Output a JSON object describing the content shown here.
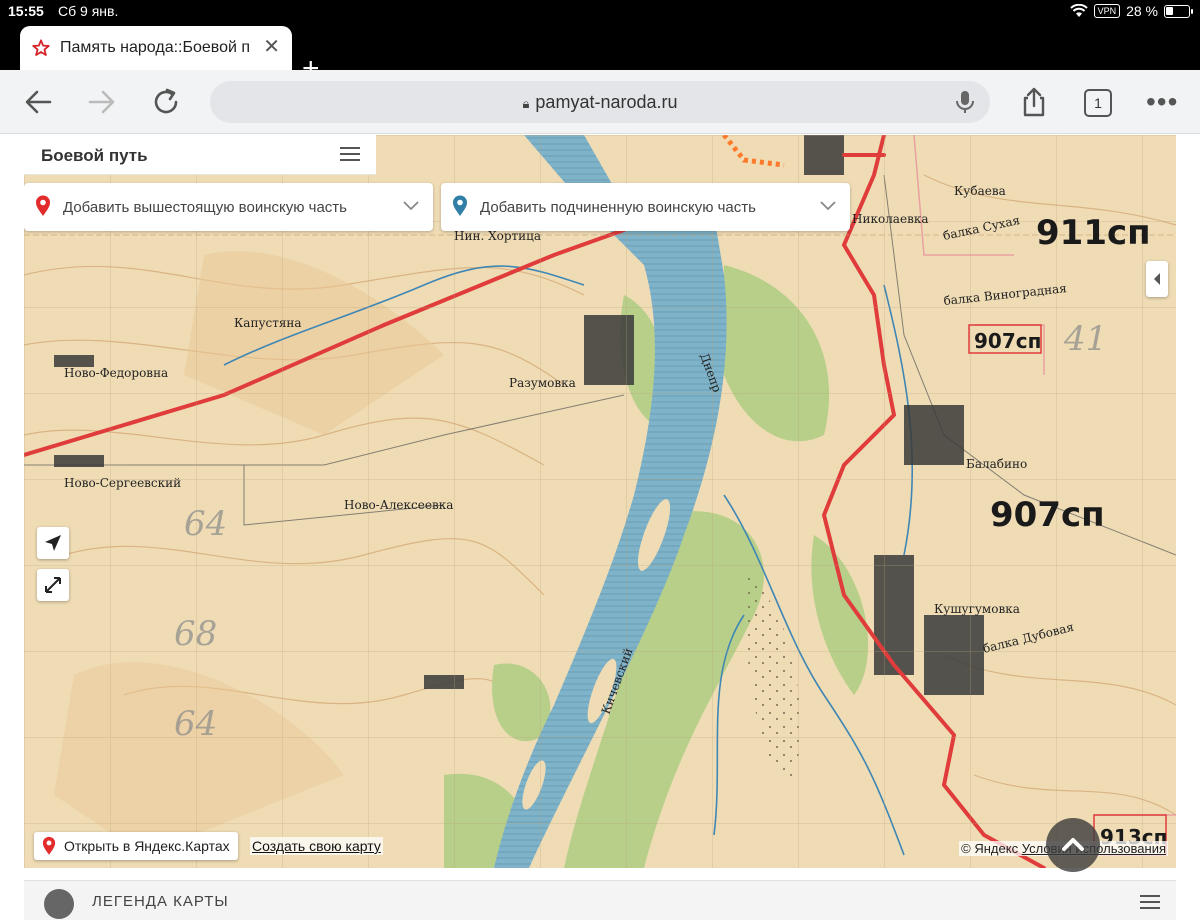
{
  "status_bar": {
    "time": "15:55",
    "date": "Сб 9 янв.",
    "vpn": "VPN",
    "battery": "28 %"
  },
  "tab": {
    "title": "Память народа::Боевой путь",
    "close": "✕"
  },
  "new_tab": "+",
  "toolbar": {
    "url": "pamyat-naroda.ru",
    "tab_count": "1",
    "more": "•••"
  },
  "panel": {
    "title": "Боевой путь"
  },
  "selectors": {
    "superior": "Добавить вышестоящую воинскую часть",
    "subordinate": "Добавить подчиненную воинскую часть"
  },
  "map_labels": {
    "units": [
      "911сп",
      "907сп",
      "907сп",
      "913сп",
      "64",
      "68"
    ],
    "places": [
      "Нин. Хортица",
      "Николаевка",
      "Кубаева",
      "Капустяна",
      "Ново-Федоровна",
      "Разумовка",
      "Балабино",
      "Ново-Сергеевский",
      "Ново-Алексеевка",
      "Кушугумовка",
      "балка Сухая",
      "балка Дубовая",
      "балка Виноградная",
      "Днепр",
      "Кичевский"
    ]
  },
  "map_footer": {
    "open_yandex": "Открыть в Яндекс.Картах",
    "create_map": "Создать свою карту",
    "copyright_prefix": "© Яндекс ",
    "copyright_link": "Условия использования"
  },
  "legend": {
    "title": "ЛЕГЕНДА КАРТЫ"
  },
  "colors": {
    "map_paper": "#efdcb5",
    "river": "#7fb3c9",
    "forest": "#b8cf8a",
    "front_line": "#e03c3c"
  }
}
